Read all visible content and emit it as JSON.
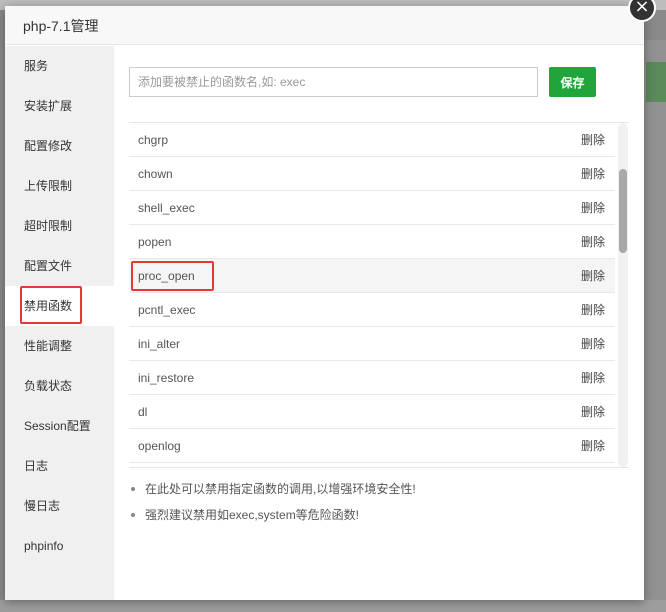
{
  "dialog": {
    "title": "php-7.1管理",
    "close_symbol": "×"
  },
  "sidebar": {
    "items": [
      {
        "label": "服务"
      },
      {
        "label": "安装扩展"
      },
      {
        "label": "配置修改"
      },
      {
        "label": "上传限制"
      },
      {
        "label": "超时限制"
      },
      {
        "label": "配置文件"
      },
      {
        "label": "禁用函数",
        "active": true
      },
      {
        "label": "性能调整"
      },
      {
        "label": "负载状态"
      },
      {
        "label": "Session配置"
      },
      {
        "label": "日志"
      },
      {
        "label": "慢日志"
      },
      {
        "label": "phpinfo"
      }
    ]
  },
  "form": {
    "placeholder": "添加要被禁止的函数名,如: exec",
    "save_label": "保存"
  },
  "functions": [
    {
      "name": "chgrp",
      "action": "删除"
    },
    {
      "name": "chown",
      "action": "删除"
    },
    {
      "name": "shell_exec",
      "action": "删除"
    },
    {
      "name": "popen",
      "action": "删除"
    },
    {
      "name": "proc_open",
      "action": "删除",
      "highlighted": true
    },
    {
      "name": "pcntl_exec",
      "action": "删除"
    },
    {
      "name": "ini_alter",
      "action": "删除"
    },
    {
      "name": "ini_restore",
      "action": "删除"
    },
    {
      "name": "dl",
      "action": "删除"
    },
    {
      "name": "openlog",
      "action": "删除"
    }
  ],
  "tips": [
    "在此处可以禁用指定函数的调用,以增强环境安全性!",
    "强烈建议禁用如exec,system等危险函数!"
  ],
  "colors": {
    "accent": "#20a53a",
    "highlight_border": "#e53935",
    "sidebar_bg": "#f0f0f0"
  }
}
